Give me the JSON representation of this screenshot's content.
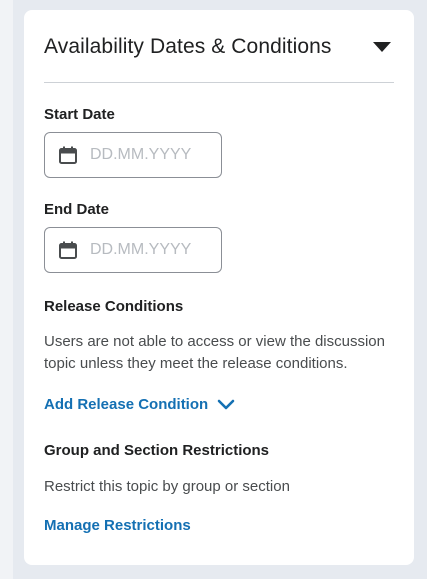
{
  "panel": {
    "title": "Availability Dates & Conditions"
  },
  "start_date": {
    "label": "Start Date",
    "placeholder": "DD.MM.YYYY",
    "value": ""
  },
  "end_date": {
    "label": "End Date",
    "placeholder": "DD.MM.YYYY",
    "value": ""
  },
  "release_conditions": {
    "heading": "Release Conditions",
    "description": "Users are not able to access or view the discussion topic unless they meet the release conditions.",
    "add_label": "Add Release Condition"
  },
  "restrictions": {
    "heading": "Group and Section Restrictions",
    "description": "Restrict this topic by group or section",
    "manage_label": "Manage Restrictions"
  },
  "colors": {
    "link": "#1470b3",
    "text": "#202122",
    "muted_text": "#494c4e",
    "placeholder": "#b7bbc0",
    "border": "#8b8f96"
  },
  "icons": {
    "toggle": "caret-down-icon",
    "date": "calendar-icon",
    "expand": "chevron-down-icon"
  }
}
